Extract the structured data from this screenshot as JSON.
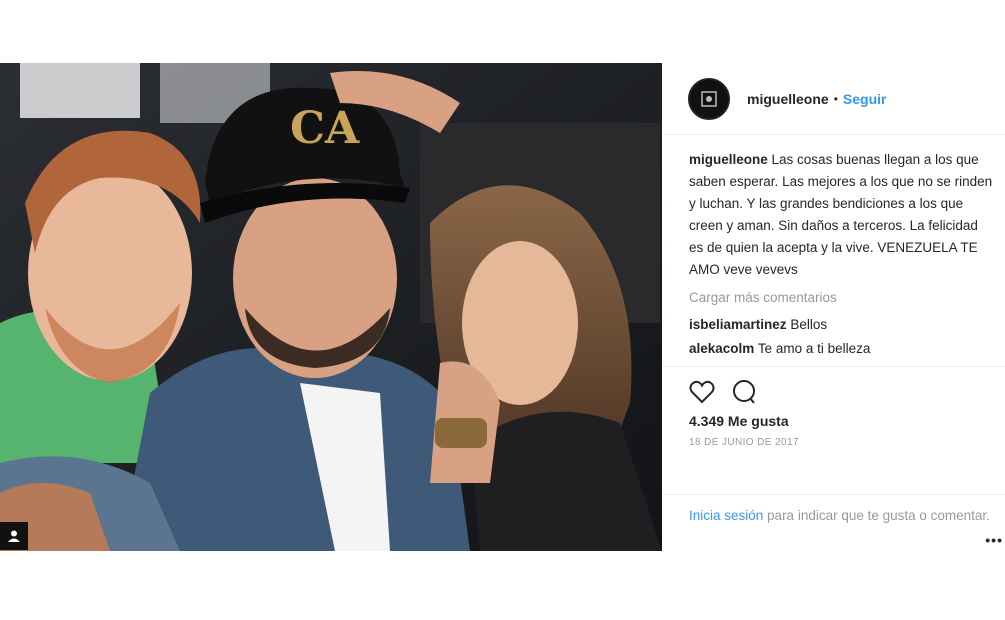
{
  "post": {
    "username": "miguelleone",
    "follow_label": "Seguir",
    "separator": "•",
    "caption_user": "miguelleone",
    "caption": "Las cosas buenas llegan a los que saben esperar. Las mejores a los que no se rinden y luchan. Y las grandes bendiciones a los que creen y aman. Sin daños a terceros. La felicidad es de quien la acepta y la vive. VENEZUELA TE AMO veve vevevs",
    "load_more": "Cargar más comentarios",
    "comments": [
      {
        "user": "isbeliamartinez",
        "text": "Bellos"
      },
      {
        "user": "alekacolm",
        "text": "Te amo a ti belleza"
      }
    ],
    "likes": "4.349 Me gusta",
    "date": "18 DE JUNIO DE 2017",
    "login_link": "Inicia sesión",
    "login_text": " para indicar que te gusta o comentar.",
    "more_dots": "•••",
    "cap_logo_text": "CA"
  },
  "colors": {
    "link": "#3897f0",
    "muted": "#999999",
    "text": "#262626"
  },
  "icons": [
    "heart-icon",
    "comment-icon",
    "user-tag-icon",
    "profile-avatar-icon"
  ]
}
